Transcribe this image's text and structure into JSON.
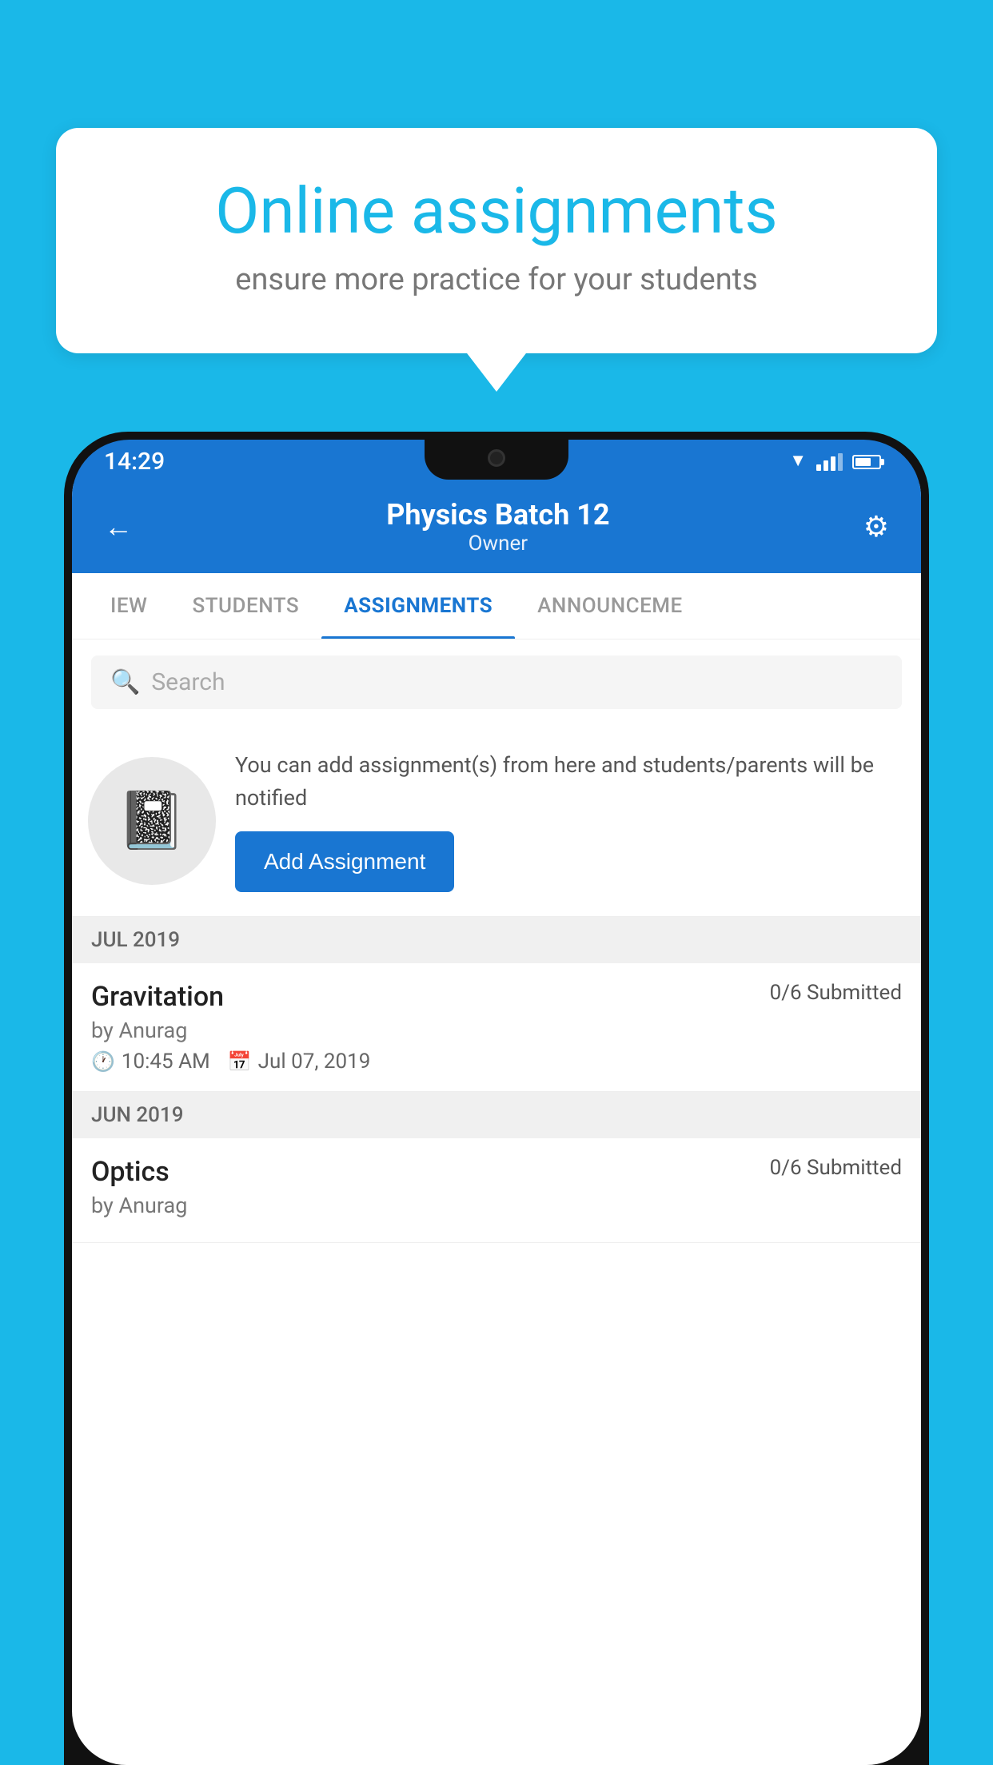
{
  "background": {
    "color": "#1ab8e8"
  },
  "speech_bubble": {
    "title": "Online assignments",
    "subtitle": "ensure more practice for your students"
  },
  "status_bar": {
    "time": "14:29"
  },
  "header": {
    "title": "Physics Batch 12",
    "subtitle": "Owner"
  },
  "tabs": [
    {
      "label": "IEW",
      "active": false
    },
    {
      "label": "STUDENTS",
      "active": false
    },
    {
      "label": "ASSIGNMENTS",
      "active": true
    },
    {
      "label": "ANNOUNCEME",
      "active": false
    }
  ],
  "search": {
    "placeholder": "Search"
  },
  "promo": {
    "description": "You can add assignment(s) from here and students/parents will be notified",
    "button_label": "Add Assignment"
  },
  "sections": [
    {
      "label": "JUL 2019",
      "assignments": [
        {
          "name": "Gravitation",
          "submitted": "0/6 Submitted",
          "author": "by Anurag",
          "time": "10:45 AM",
          "date": "Jul 07, 2019"
        }
      ]
    },
    {
      "label": "JUN 2019",
      "assignments": [
        {
          "name": "Optics",
          "submitted": "0/6 Submitted",
          "author": "by Anurag",
          "time": "",
          "date": ""
        }
      ]
    }
  ]
}
